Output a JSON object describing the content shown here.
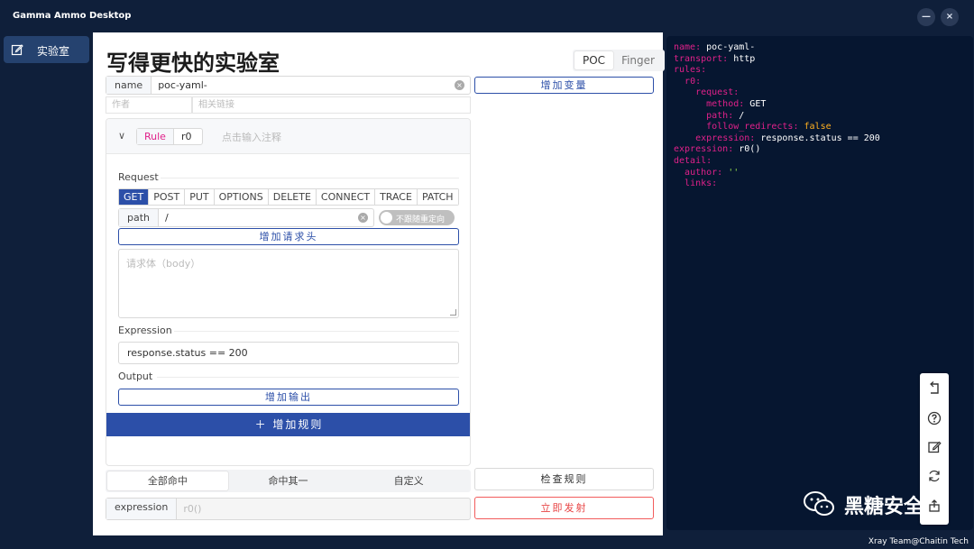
{
  "window": {
    "title": "Gamma Ammo Desktop",
    "minimize_label": "—",
    "close_label": "×"
  },
  "sidebar": {
    "items": [
      {
        "label": "实验室",
        "icon": "edit-icon"
      }
    ]
  },
  "page": {
    "title": "写得更快的实验室"
  },
  "type_switch": {
    "options": [
      "POC",
      "Finger"
    ],
    "selected": "POC"
  },
  "name_field": {
    "label": "name",
    "value": "poc-yaml-"
  },
  "add_variable": {
    "label": "增加变量"
  },
  "author_field": {
    "placeholder": "作者"
  },
  "link_field": {
    "placeholder": "相关链接"
  },
  "rule": {
    "label": "Rule",
    "id": "r0",
    "note_placeholder": "点击输入注释",
    "request_label": "Request",
    "methods": [
      "GET",
      "POST",
      "PUT",
      "OPTIONS",
      "DELETE",
      "CONNECT",
      "TRACE",
      "PATCH"
    ],
    "active_method": "GET",
    "path_label": "path",
    "path_value": "/",
    "redirect_toggle": {
      "label": "不跟随重定向",
      "on": false
    },
    "add_header_label": "增加请求头",
    "body_placeholder": "请求体（body）",
    "expression_label": "Expression",
    "expression_value": "response.status == 200",
    "output_label": "Output",
    "add_output_label": "增加输出"
  },
  "add_rule": {
    "label": "＋ 增加规则"
  },
  "match_modes": {
    "options": [
      "全部命中",
      "命中其一",
      "自定义"
    ],
    "selected": "全部命中"
  },
  "check_rule": {
    "label": "检查规则"
  },
  "expression_bar": {
    "label": "expression",
    "placeholder": "r0()"
  },
  "fire": {
    "label": "立即发射"
  },
  "yaml": {
    "lines": [
      {
        "indent": "",
        "key": "name:",
        "value": " poc-yaml-"
      },
      {
        "indent": "",
        "key": "transport:",
        "value": " http"
      },
      {
        "indent": "",
        "key": "rules:",
        "value": ""
      },
      {
        "indent": "  ",
        "key": "r0:",
        "value": ""
      },
      {
        "indent": "    ",
        "key": "request:",
        "value": ""
      },
      {
        "indent": "      ",
        "key": "method:",
        "value": " GET"
      },
      {
        "indent": "      ",
        "key": "path:",
        "value": " /"
      },
      {
        "indent": "      ",
        "key": "follow_redirects:",
        "value": " false",
        "kind": "bool"
      },
      {
        "indent": "    ",
        "key": "expression:",
        "value": " response.status == 200"
      },
      {
        "indent": "",
        "key": "expression:",
        "value": " r0()"
      },
      {
        "indent": "",
        "key": "detail:",
        "value": ""
      },
      {
        "indent": "  ",
        "key": "author:",
        "value": " ''",
        "kind": "str"
      },
      {
        "indent": "  ",
        "key": "links:",
        "value": ""
      }
    ]
  },
  "float_toolbar": {
    "icons": [
      "back-icon",
      "help-icon",
      "edit-icon",
      "refresh-icon",
      "export-icon"
    ]
  },
  "footer": {
    "credit": "Xray Team@Chaitin Tech"
  },
  "watermark": {
    "text": "黑糖安全"
  },
  "colors": {
    "primary": "#2c4fa8",
    "danger": "#e84545",
    "chrome": "#0f1f3a",
    "yaml_bg": "#061630",
    "yaml_key": "#e0218a",
    "yaml_bool": "#ffb020"
  }
}
